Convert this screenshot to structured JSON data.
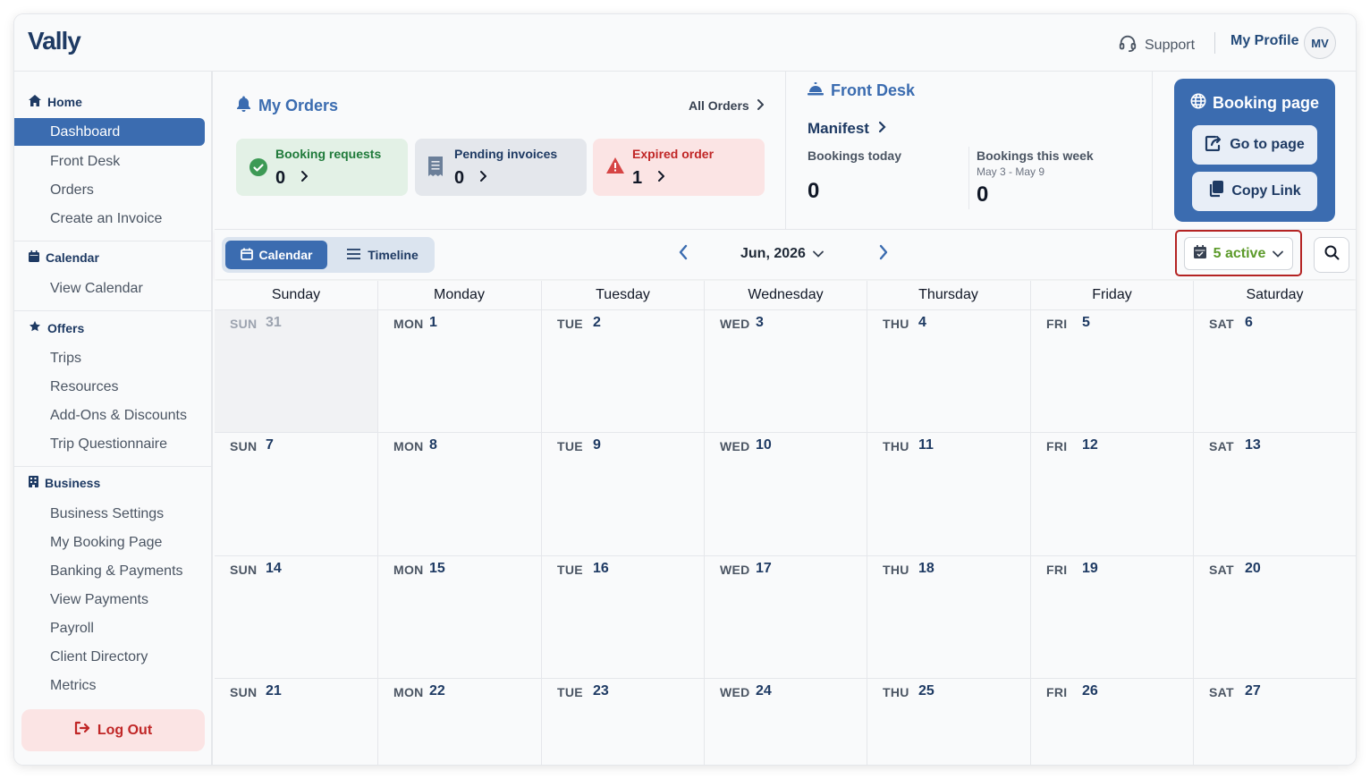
{
  "header": {
    "logo": "Vally",
    "support_label": "Support",
    "profile_label": "My Profile",
    "avatar_initials": "MV"
  },
  "sidebar": {
    "sections": [
      {
        "title": "Home",
        "icon": "home-icon",
        "items": [
          "Dashboard",
          "Front Desk",
          "Orders",
          "Create an Invoice"
        ]
      },
      {
        "title": "Calendar",
        "icon": "calendar-icon",
        "items": [
          "View Calendar"
        ]
      },
      {
        "title": "Offers",
        "icon": "star-icon",
        "items": [
          "Trips",
          "Resources",
          "Add-Ons & Discounts",
          "Trip Questionnaire"
        ]
      },
      {
        "title": "Business",
        "icon": "building-icon",
        "items": [
          "Business Settings",
          "My Booking Page",
          "Banking & Payments",
          "View Payments",
          "Payroll",
          "Client Directory",
          "Metrics"
        ]
      }
    ],
    "active_item": "Dashboard",
    "logout_label": "Log Out"
  },
  "orders": {
    "title": "My Orders",
    "all_orders_label": "All Orders",
    "cards": [
      {
        "label": "Booking requests",
        "count": "0",
        "icon": "check-circle-icon",
        "color": "#1f7a3a",
        "bg": "#e3f1e6"
      },
      {
        "label": "Pending invoices",
        "count": "0",
        "icon": "receipt-icon",
        "color": "#1e3a63",
        "bg": "#e4e7ec"
      },
      {
        "label": "Expired order",
        "count": "1",
        "icon": "warning-icon",
        "color": "#c02626",
        "bg": "#fbe4e4"
      }
    ]
  },
  "front_desk": {
    "title": "Front Desk",
    "manifest_label": "Manifest",
    "today_label": "Bookings today",
    "today_value": "0",
    "week_label": "Bookings this week",
    "week_range": "May 3 - May 9",
    "week_value": "0"
  },
  "booking_page": {
    "title": "Booking page",
    "go_label": "Go to page",
    "copy_label": "Copy Link"
  },
  "toolbar": {
    "calendar_tab": "Calendar",
    "timeline_tab": "Timeline",
    "month": "Jun, 2026",
    "active_filter": "5 active"
  },
  "calendar": {
    "weekdays": [
      "Sunday",
      "Monday",
      "Tuesday",
      "Wednesday",
      "Thursday",
      "Friday",
      "Saturday"
    ],
    "weeks": [
      [
        {
          "dn": "SUN",
          "d": "31",
          "out": true
        },
        {
          "dn": "MON",
          "d": "1"
        },
        {
          "dn": "TUE",
          "d": "2"
        },
        {
          "dn": "WED",
          "d": "3"
        },
        {
          "dn": "THU",
          "d": "4"
        },
        {
          "dn": "FRI",
          "d": "5"
        },
        {
          "dn": "SAT",
          "d": "6"
        }
      ],
      [
        {
          "dn": "SUN",
          "d": "7"
        },
        {
          "dn": "MON",
          "d": "8"
        },
        {
          "dn": "TUE",
          "d": "9"
        },
        {
          "dn": "WED",
          "d": "10"
        },
        {
          "dn": "THU",
          "d": "11"
        },
        {
          "dn": "FRI",
          "d": "12"
        },
        {
          "dn": "SAT",
          "d": "13"
        }
      ],
      [
        {
          "dn": "SUN",
          "d": "14"
        },
        {
          "dn": "MON",
          "d": "15"
        },
        {
          "dn": "TUE",
          "d": "16"
        },
        {
          "dn": "WED",
          "d": "17"
        },
        {
          "dn": "THU",
          "d": "18"
        },
        {
          "dn": "FRI",
          "d": "19"
        },
        {
          "dn": "SAT",
          "d": "20"
        }
      ],
      [
        {
          "dn": "SUN",
          "d": "21"
        },
        {
          "dn": "MON",
          "d": "22"
        },
        {
          "dn": "TUE",
          "d": "23"
        },
        {
          "dn": "WED",
          "d": "24"
        },
        {
          "dn": "THU",
          "d": "25"
        },
        {
          "dn": "FRI",
          "d": "26"
        },
        {
          "dn": "SAT",
          "d": "27"
        }
      ]
    ]
  }
}
